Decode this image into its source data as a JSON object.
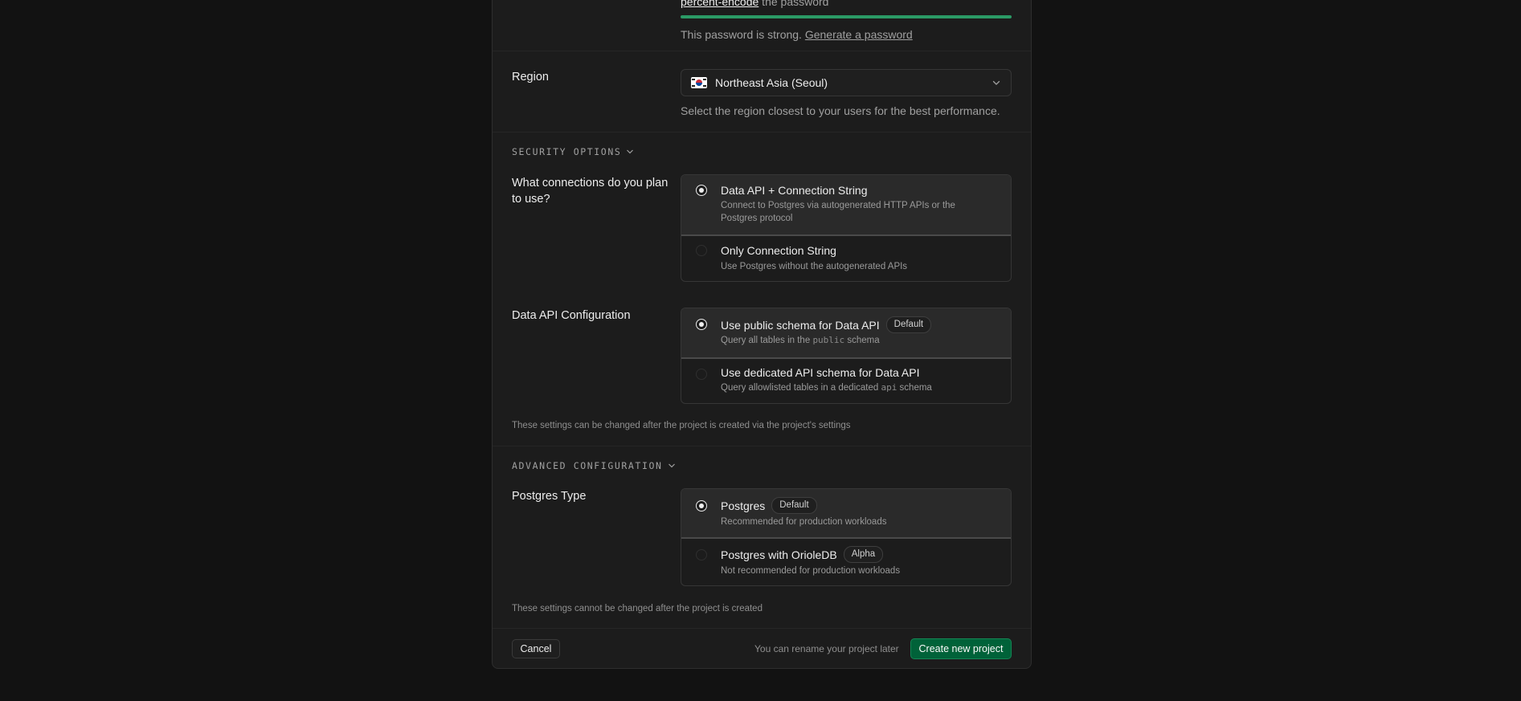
{
  "password": {
    "hint_link": "percent-encode",
    "hint_suffix": " the password",
    "strength_text": "This password is strong.",
    "generate_link": "Generate a password",
    "strength_fraction": 1.0
  },
  "region": {
    "label": "Region",
    "selected": "Northeast Asia (Seoul)",
    "flag_icon": "south-korea-flag-icon",
    "help": "Select the region closest to your users for the best performance."
  },
  "security": {
    "section_title": "SECURITY OPTIONS",
    "connections_label": "What connections do you plan to use?",
    "connections_options": [
      {
        "title": "Data API + Connection String",
        "desc": "Connect to Postgres via autogenerated HTTP APIs or the Postgres protocol",
        "selected": true
      },
      {
        "title": "Only Connection String",
        "desc": "Use Postgres without the autogenerated APIs",
        "selected": false
      }
    ],
    "data_api_label": "Data API Configuration",
    "data_api_options": [
      {
        "title": "Use public schema for Data API",
        "badge": "Default",
        "desc_pre": "Query all tables in the",
        "desc_code": "public",
        "desc_post": "schema",
        "selected": true
      },
      {
        "title": "Use dedicated API schema for Data API",
        "desc_pre": "Query allowlisted tables in a dedicated",
        "desc_code": "api",
        "desc_post": "schema",
        "selected": false
      }
    ],
    "footnote": "These settings can be changed after the project is created via the project's settings"
  },
  "advanced": {
    "section_title": "ADVANCED CONFIGURATION",
    "postgres_type_label": "Postgres Type",
    "options": [
      {
        "title": "Postgres",
        "badge": "Default",
        "desc": "Recommended for production workloads",
        "selected": true
      },
      {
        "title": "Postgres with OrioleDB",
        "badge": "Alpha",
        "desc": "Not recommended for production workloads",
        "selected": false
      }
    ],
    "footnote": "These settings cannot be changed after the project is created"
  },
  "footer": {
    "cancel": "Cancel",
    "rename_note": "You can rename your project later",
    "create": "Create new project"
  },
  "colors": {
    "accent_green": "#006239",
    "strength_green": "#2b9a66",
    "background": "#121212",
    "panel": "#1c1c1c"
  }
}
